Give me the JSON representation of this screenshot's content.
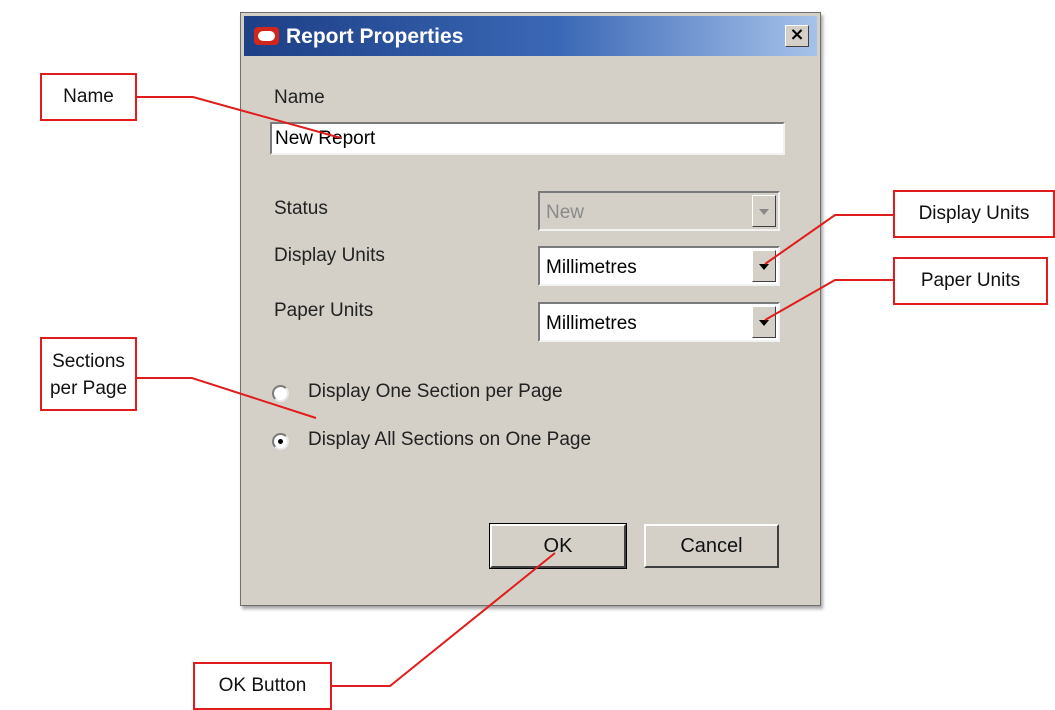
{
  "dialog": {
    "title": "Report Properties",
    "close_glyph": "×",
    "name_label": "Name",
    "name_value": "New Report",
    "status_label": "Status",
    "status_value": "New",
    "display_units_label": "Display Units",
    "display_units_value": "Millimetres",
    "paper_units_label": "Paper Units",
    "paper_units_value": "Millimetres",
    "radio_one_section": "Display One Section per Page",
    "radio_all_sections": "Display All Sections on One Page",
    "selected_radio": "radio_all_sections",
    "ok_label": "OK",
    "cancel_label": "Cancel"
  },
  "callouts": {
    "name": "Name",
    "display_units": "Display Units",
    "paper_units": "Paper Units",
    "sections_line1": "Sections",
    "sections_line2": "per Page",
    "ok_button": "OK Button"
  },
  "colors": {
    "dialog_background": "#d4d0c8",
    "titlebar_start": "#1d3f86",
    "titlebar_end": "#a6c2ea",
    "callout_border": "#e01c1c",
    "logo_red": "#d0261b"
  },
  "icons": {
    "app_logo": "oracle-logo-icon",
    "close": "close-icon",
    "dropdown": "chevron-down-icon"
  }
}
